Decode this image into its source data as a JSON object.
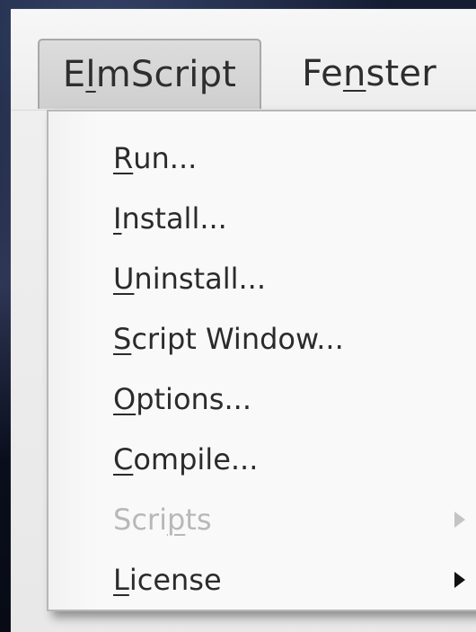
{
  "menubar": {
    "items": [
      {
        "id": "elmscript",
        "label": "ElmScript",
        "label_before": "E",
        "accel_char": "l",
        "label_after": "mScript",
        "state": "open"
      },
      {
        "id": "fenster",
        "label": "Fenster",
        "label_before": "Fe",
        "accel_char": "n",
        "label_after": "ster",
        "state": "normal"
      }
    ]
  },
  "dropdown": {
    "parent": "ElmScript",
    "items": [
      {
        "id": "run",
        "label": "Run...",
        "label_before": "",
        "accel_char": "R",
        "label_after": "un...",
        "enabled": true,
        "submenu": false,
        "icon": ""
      },
      {
        "id": "install",
        "label": "Install...",
        "label_before": "",
        "accel_char": "I",
        "label_after": "nstall...",
        "enabled": true,
        "submenu": false,
        "icon": ""
      },
      {
        "id": "uninstall",
        "label": "Uninstall...",
        "label_before": "",
        "accel_char": "U",
        "label_after": "ninstall...",
        "enabled": true,
        "submenu": false,
        "icon": ""
      },
      {
        "id": "script-window",
        "label": "Script Window...",
        "label_before": "",
        "accel_char": "S",
        "label_after": "cript Window...",
        "enabled": true,
        "submenu": false,
        "icon": ""
      },
      {
        "id": "options",
        "label": "Options...",
        "label_before": "",
        "accel_char": "O",
        "label_after": "ptions...",
        "enabled": true,
        "submenu": false,
        "icon": ""
      },
      {
        "id": "compile",
        "label": "Compile...",
        "label_before": "",
        "accel_char": "C",
        "label_after": "ompile...",
        "enabled": true,
        "submenu": false,
        "icon": ""
      },
      {
        "id": "scripts",
        "label": "Scripts",
        "label_before": "Scri",
        "accel_char": "p",
        "label_after": "ts",
        "enabled": false,
        "submenu": true,
        "icon": "chevron-right-icon"
      },
      {
        "id": "license",
        "label": "License",
        "label_before": "",
        "accel_char": "L",
        "label_after": "icense",
        "enabled": true,
        "submenu": true,
        "icon": "chevron-right-icon"
      }
    ]
  },
  "colors": {
    "menu_text": "#2b2b2b",
    "disabled_text": "#b8b8b8",
    "menu_background": "#f9f9f9",
    "active_menu_background": "#d6d6d6",
    "desktop_background": "#0a0f1c"
  }
}
